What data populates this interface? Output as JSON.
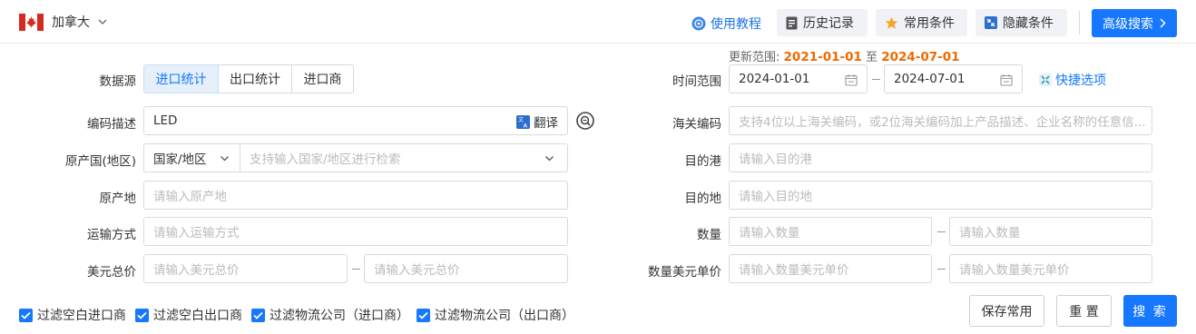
{
  "header": {
    "country": "加拿大",
    "help_label": "使用教程",
    "history_label": "历史记录",
    "common_label": "常用条件",
    "hide_label": "隐藏条件",
    "advanced_label": "高级搜索",
    "accent": "#1677ff"
  },
  "range_note": {
    "prefix": "更新范围:",
    "start": "2021-01-01",
    "sep": "至",
    "end": "2024-07-01"
  },
  "form": {
    "datasource_label": "数据源",
    "datasource_options": [
      "进口统计",
      "出口统计",
      "进口商"
    ],
    "datasource_selected": "进口统计",
    "code_desc_label": "编码描述",
    "code_desc_value": "LED",
    "translate_label": "翻译",
    "origin_label": "原产国(地区)",
    "origin_type": "国家/地区",
    "origin_placeholder": "支持输入国家/地区进行检索",
    "origin_place_label": "原产地",
    "origin_place_placeholder": "请输入原产地",
    "transport_label": "运输方式",
    "transport_placeholder": "请输入运输方式",
    "usd_total_label": "美元总价",
    "usd_total_min_placeholder": "请输入美元总价",
    "usd_total_max_placeholder": "请输入美元总价",
    "time_label": "时间范围",
    "time_start": "2024-01-01",
    "time_end": "2024-07-01",
    "quick_label": "快捷选项",
    "hs_label": "海关编码",
    "hs_placeholder": "支持4位以上海关编码，或2位海关编码加上产品描述、企业名称的任意信...",
    "dest_port_label": "目的港",
    "dest_port_placeholder": "请输入目的港",
    "dest_label": "目的地",
    "dest_placeholder": "请输入目的地",
    "qty_label": "数量",
    "qty_min_placeholder": "请输入数量",
    "qty_max_placeholder": "请输入数量",
    "unit_price_label": "数量美元单价",
    "unit_price_min_placeholder": "请输入数量美元单价",
    "unit_price_max_placeholder": "请输入数量美元单价"
  },
  "filters": [
    {
      "label": "过滤空白进口商",
      "checked": true
    },
    {
      "label": "过滤空白出口商",
      "checked": true
    },
    {
      "label": "过滤物流公司（进口商）",
      "checked": true
    },
    {
      "label": "过滤物流公司（出口商）",
      "checked": true
    }
  ],
  "actions": {
    "save_label": "保存常用",
    "reset_label": "重 置",
    "search_label": "搜 索"
  }
}
